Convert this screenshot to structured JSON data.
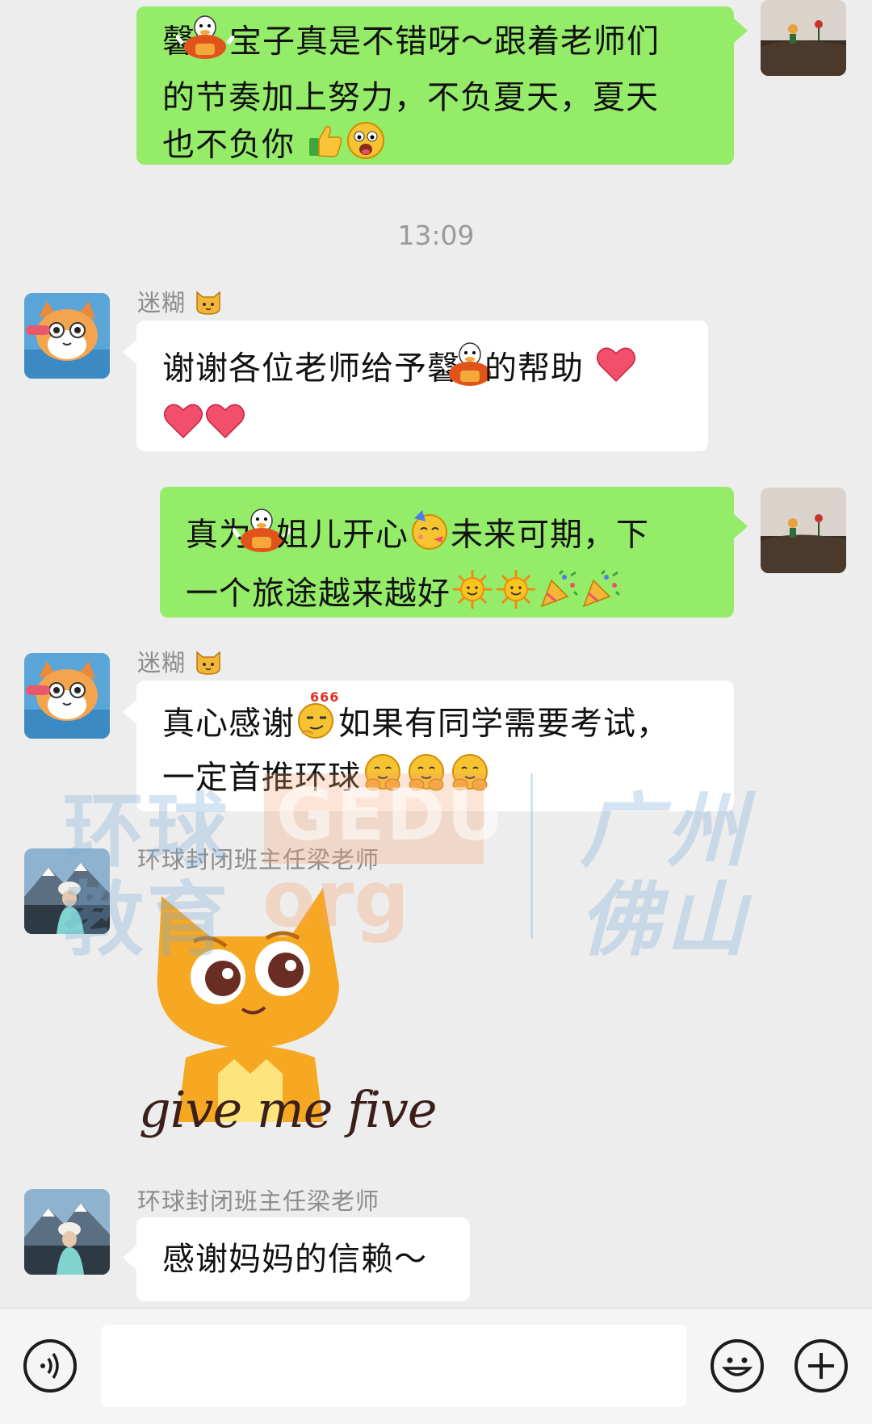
{
  "chat": {
    "time_divider": "13:09",
    "messages": [
      {
        "sender": "self",
        "text_a": "馨",
        "text_b": "宝子真是不错呀～跟着老师们",
        "line2": "的节奏加上努力，不负夏天，夏天",
        "line3": "也不负你"
      },
      {
        "sender": "迷糊",
        "text_a": "谢谢各位老师给予馨",
        "text_b": "的帮助"
      },
      {
        "sender": "self",
        "text_a": "真为",
        "text_b": "姐儿开心",
        "text_c": "未来可期，下",
        "line2": "一个旅途越来越好"
      },
      {
        "sender": "迷糊",
        "text_a": "真心感谢",
        "text_b": "如果有同学需要考试，",
        "line2": "一定首推环球"
      },
      {
        "sender": "环球封闭班主任梁老师",
        "sticker_text": "give me five"
      },
      {
        "sender": "环球封闭班主任梁老师",
        "text": "感谢妈妈的信赖～"
      }
    ]
  },
  "names": {
    "mihu": "迷糊",
    "teacher": "环球封闭班主任梁老师"
  },
  "emoji_badge": "666",
  "watermark": {
    "left_top": "环球",
    "left_bottom": "教育",
    "brand": "GEDU",
    "domain": "org",
    "right_top": "广州",
    "right_bottom": "佛山"
  },
  "colors": {
    "self_bubble": "#95ec69",
    "other_bubble": "#ffffff",
    "background": "#ededed"
  },
  "icons": [
    "duck-sticker-icon",
    "thumbs-up-icon",
    "surprised-face-icon",
    "heart-icon",
    "party-face-icon",
    "sun-icon",
    "party-popper-icon",
    "smirk-666-icon",
    "hug-face-icon",
    "cat-face-icon",
    "voice-icon",
    "emoji-icon",
    "plus-icon"
  ]
}
